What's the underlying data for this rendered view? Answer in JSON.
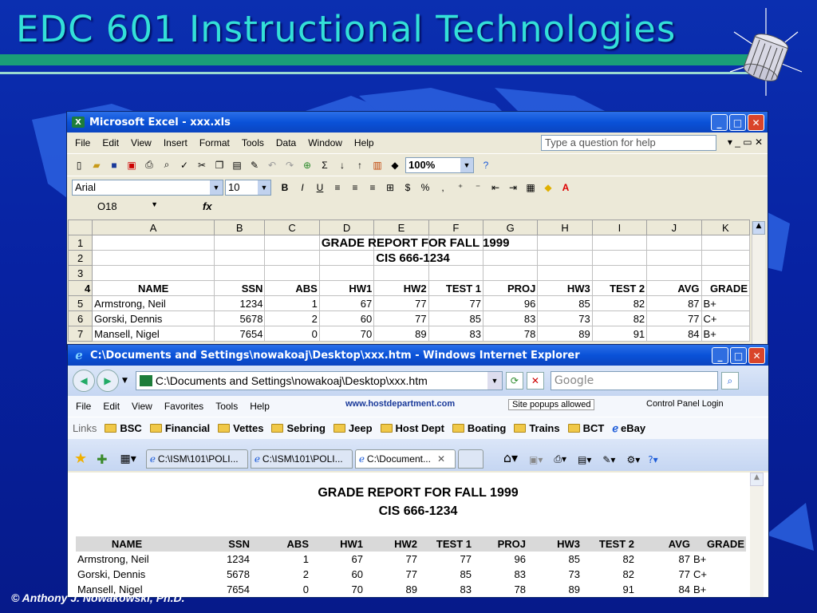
{
  "slide": {
    "title": "EDC 601 Instructional Technologies",
    "footer": "© Anthony J. Nowakowski, Ph.D."
  },
  "excel": {
    "title": "Microsoft Excel - xxx.xls",
    "menu": [
      "File",
      "Edit",
      "View",
      "Insert",
      "Format",
      "Tools",
      "Data",
      "Window",
      "Help"
    ],
    "help_placeholder": "Type a question for help",
    "zoom": "100%",
    "font": "Arial",
    "font_size": "10",
    "name_box": "O18",
    "fx": "fx",
    "columns": [
      "A",
      "B",
      "C",
      "D",
      "E",
      "F",
      "G",
      "H",
      "I",
      "J",
      "K"
    ],
    "rows": [
      {
        "n": "1",
        "cells": [
          "",
          "",
          "",
          "GRADE REPORT FOR FALL 1999"
        ]
      },
      {
        "n": "2",
        "cells": [
          "",
          "",
          "",
          "",
          "CIS 666-1234"
        ]
      },
      {
        "n": "3",
        "cells": []
      },
      {
        "n": "4",
        "cells": [
          "NAME",
          "SSN",
          "ABS",
          "HW1",
          "HW2",
          "TEST 1",
          "PROJ",
          "HW3",
          "TEST 2",
          "AVG",
          "GRADE"
        ]
      },
      {
        "n": "5",
        "cells": [
          "Armstrong, Neil",
          "1234",
          "1",
          "67",
          "77",
          "77",
          "96",
          "85",
          "82",
          "87",
          "B+"
        ]
      },
      {
        "n": "6",
        "cells": [
          "Gorski, Dennis",
          "5678",
          "2",
          "60",
          "77",
          "85",
          "83",
          "73",
          "82",
          "77",
          "C+"
        ]
      },
      {
        "n": "7",
        "cells": [
          "Mansell, Nigel",
          "7654",
          "0",
          "70",
          "89",
          "83",
          "78",
          "89",
          "91",
          "84",
          "B+"
        ]
      }
    ]
  },
  "ie": {
    "title": "C:\\Documents and Settings\\nowakoaj\\Desktop\\xxx.htm - Windows Internet Explorer",
    "address": "C:\\Documents and Settings\\nowakoaj\\Desktop\\xxx.htm",
    "search_placeholder": "Google",
    "menu": [
      "File",
      "Edit",
      "View",
      "Favorites",
      "Tools",
      "Help"
    ],
    "host_link": "www.hostdepartment.com",
    "popups": "Site popups allowed",
    "control_panel": "Control Panel Login",
    "links_label": "Links",
    "links": [
      "BSC",
      "Financial",
      "Vettes",
      "Sebring",
      "Jeep",
      "Host Dept",
      "Boating",
      "Trains",
      "BCT",
      "eBay"
    ],
    "tabs": [
      "C:\\ISM\\101\\POLI...",
      "C:\\ISM\\101\\POLI...",
      "C:\\Document..."
    ],
    "page_title1": "GRADE REPORT FOR FALL 1999",
    "page_title2": "CIS 666-1234",
    "headers": [
      "NAME",
      "SSN",
      "ABS",
      "HW1",
      "HW2",
      "TEST 1",
      "PROJ",
      "HW3",
      "TEST 2",
      "AVG",
      "GRADE"
    ],
    "rows": [
      [
        "Armstrong, Neil",
        "1234",
        "1",
        "67",
        "77",
        "77",
        "96",
        "85",
        "82",
        "87",
        "B+"
      ],
      [
        "Gorski, Dennis",
        "5678",
        "2",
        "60",
        "77",
        "85",
        "83",
        "73",
        "82",
        "77",
        "C+"
      ],
      [
        "Mansell, Nigel",
        "7654",
        "0",
        "70",
        "89",
        "83",
        "78",
        "89",
        "91",
        "84",
        "B+"
      ]
    ]
  }
}
